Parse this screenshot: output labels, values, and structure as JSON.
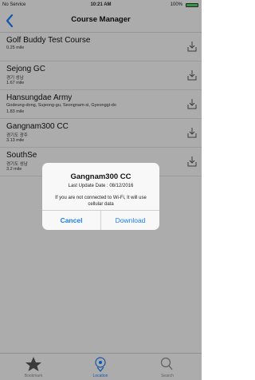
{
  "status_bar": {
    "carrier": "No Service",
    "time": "10:21 AM",
    "battery": "100%",
    "battery_level": 1.0
  },
  "nav": {
    "back_icon": "chevron-left",
    "title": "Course Manager"
  },
  "courses": [
    {
      "name": "Golf Buddy Test Course",
      "address": "",
      "distance": "0.25 mile"
    },
    {
      "name": "Sejong GC",
      "address": "경기 성남",
      "distance": "1.67 mile"
    },
    {
      "name": "Hansungdae Army",
      "address": "Godeung-dong, Sujeong-gu, Seongnam-si, Gyeonggi-do",
      "distance": "1.83 mile"
    },
    {
      "name": "Gangnam300 CC",
      "address": "경기도 광주",
      "distance": "3.13 mile"
    },
    {
      "name": "SouthSe",
      "address": "경기도 성남",
      "distance": "3.2 mile"
    }
  ],
  "alert": {
    "title": "Gangnam300 CC",
    "subtitle": "Last Update Date : 08/12/2016",
    "message": "If you are not connected to Wi-Fi, It will use cellular data",
    "cancel_label": "Cancel",
    "download_label": "Download"
  },
  "tabs": [
    {
      "label": "Bookmark",
      "icon": "star-icon"
    },
    {
      "label": "Location",
      "icon": "location-pin-icon"
    },
    {
      "label": "Search",
      "icon": "search-icon"
    }
  ],
  "colors": {
    "accent": "#1a7df5",
    "battery": "#4cd964"
  }
}
